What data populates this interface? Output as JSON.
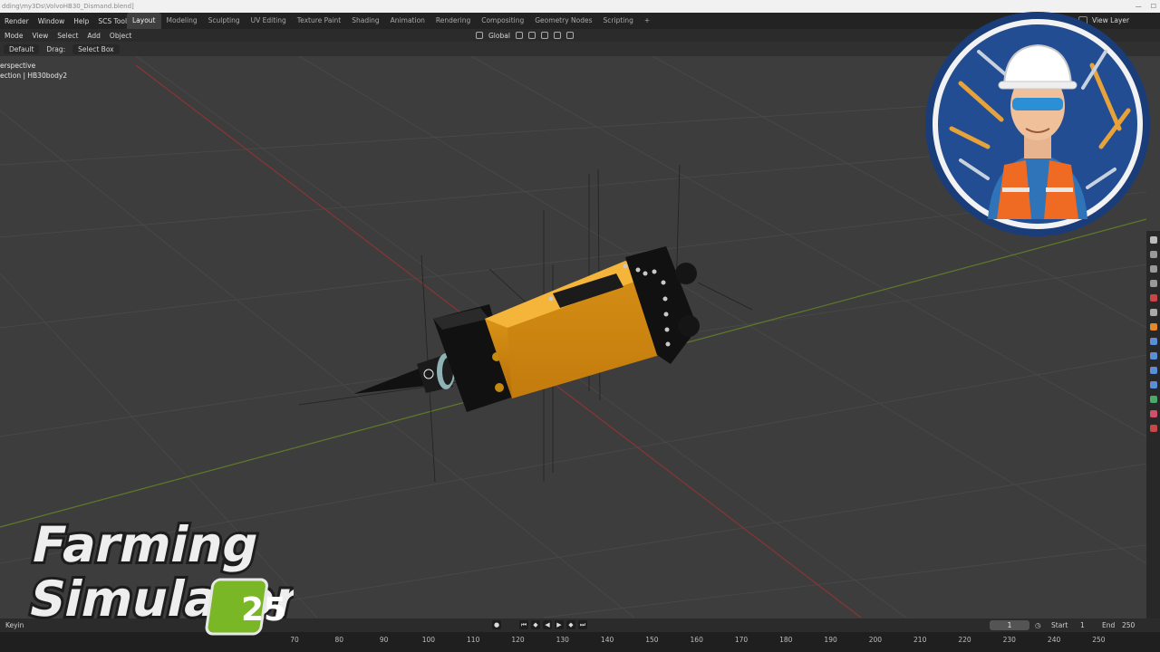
{
  "titlebar": {
    "path": "dding\\my3Ds\\VolvoHB30_Dismand.blend]"
  },
  "menu": [
    "Render",
    "Window",
    "Help",
    "SCS Tools"
  ],
  "workspaces": [
    {
      "label": "Layout",
      "active": true
    },
    {
      "label": "Modeling"
    },
    {
      "label": "Sculpting"
    },
    {
      "label": "UV Editing"
    },
    {
      "label": "Texture Paint"
    },
    {
      "label": "Shading"
    },
    {
      "label": "Animation"
    },
    {
      "label": "Rendering"
    },
    {
      "label": "Compositing"
    },
    {
      "label": "Geometry Nodes"
    },
    {
      "label": "Scripting"
    },
    {
      "label": "+"
    }
  ],
  "view_layer": "View Layer",
  "header2": {
    "mode": "Mode",
    "menu": [
      "View",
      "Select",
      "Add",
      "Object"
    ],
    "transform": "Global"
  },
  "header3": {
    "orientation": "Default",
    "drag_label": "Drag:",
    "drag_value": "Select Box"
  },
  "viewport": {
    "view_name": "erspective",
    "collection": "ection | HB30body2"
  },
  "timeline": {
    "keying": "Keyin",
    "current_frame": "1",
    "start_label": "Start",
    "start": "1",
    "end_label": "End",
    "end": "250",
    "ticks": [
      "70",
      "80",
      "90",
      "100",
      "110",
      "120",
      "130",
      "140",
      "150",
      "160",
      "170",
      "180",
      "190",
      "200",
      "210",
      "220",
      "230",
      "240",
      "250"
    ]
  },
  "overlay": {
    "game_title_line1": "Farming",
    "game_title_line2": "Simulator",
    "game_number": "25"
  },
  "colors": {
    "accent_orange": "#e39b13",
    "x_axis": "#a63a3a",
    "y_axis": "#6f8a2f",
    "fs_green": "#7ab726"
  }
}
